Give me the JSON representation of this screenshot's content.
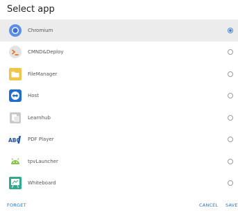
{
  "dialog": {
    "title": "Select app",
    "apps": [
      {
        "label": "Chromium",
        "icon": "chromium-icon",
        "selected": true
      },
      {
        "label": "CMND&Deploy",
        "icon": "cmnd-deploy-icon",
        "selected": false
      },
      {
        "label": "FileManager",
        "icon": "file-manager-icon",
        "selected": false
      },
      {
        "label": "Host",
        "icon": "host-icon",
        "selected": false
      },
      {
        "label": "Learnhub",
        "icon": "learnhub-icon",
        "selected": false
      },
      {
        "label": "PDF Player",
        "icon": "pdf-player-icon",
        "selected": false
      },
      {
        "label": "tpvLauncher",
        "icon": "tpv-launcher-icon",
        "selected": false
      },
      {
        "label": "Whiteboard",
        "icon": "whiteboard-icon",
        "selected": false
      }
    ],
    "icon_text": {
      "pdf_player": "ABC"
    },
    "actions": {
      "forget": "FORGET",
      "cancel": "CANCEL",
      "save": "SAVE"
    },
    "colors": {
      "accent": "#3f7fd3",
      "selected_row": "#ececec"
    }
  }
}
